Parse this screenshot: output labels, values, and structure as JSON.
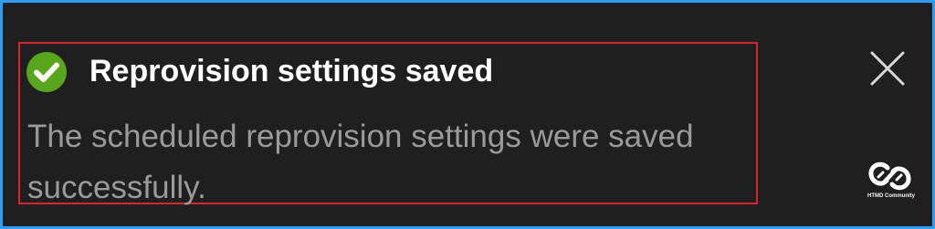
{
  "notification": {
    "title": "Reprovision settings saved",
    "message": "The scheduled reprovision settings were saved successfully.",
    "status_icon": "success-checkmark-icon",
    "close_icon": "close-icon"
  },
  "watermark": {
    "text": "HTMD Community",
    "logo_icon": "htmd-community-logo"
  },
  "colors": {
    "background": "#1f1f1f",
    "frame": "#2a9df4",
    "highlight_border": "#d8252d",
    "success": "#58a61c",
    "title": "#ffffff",
    "message": "#9a9a9a"
  }
}
